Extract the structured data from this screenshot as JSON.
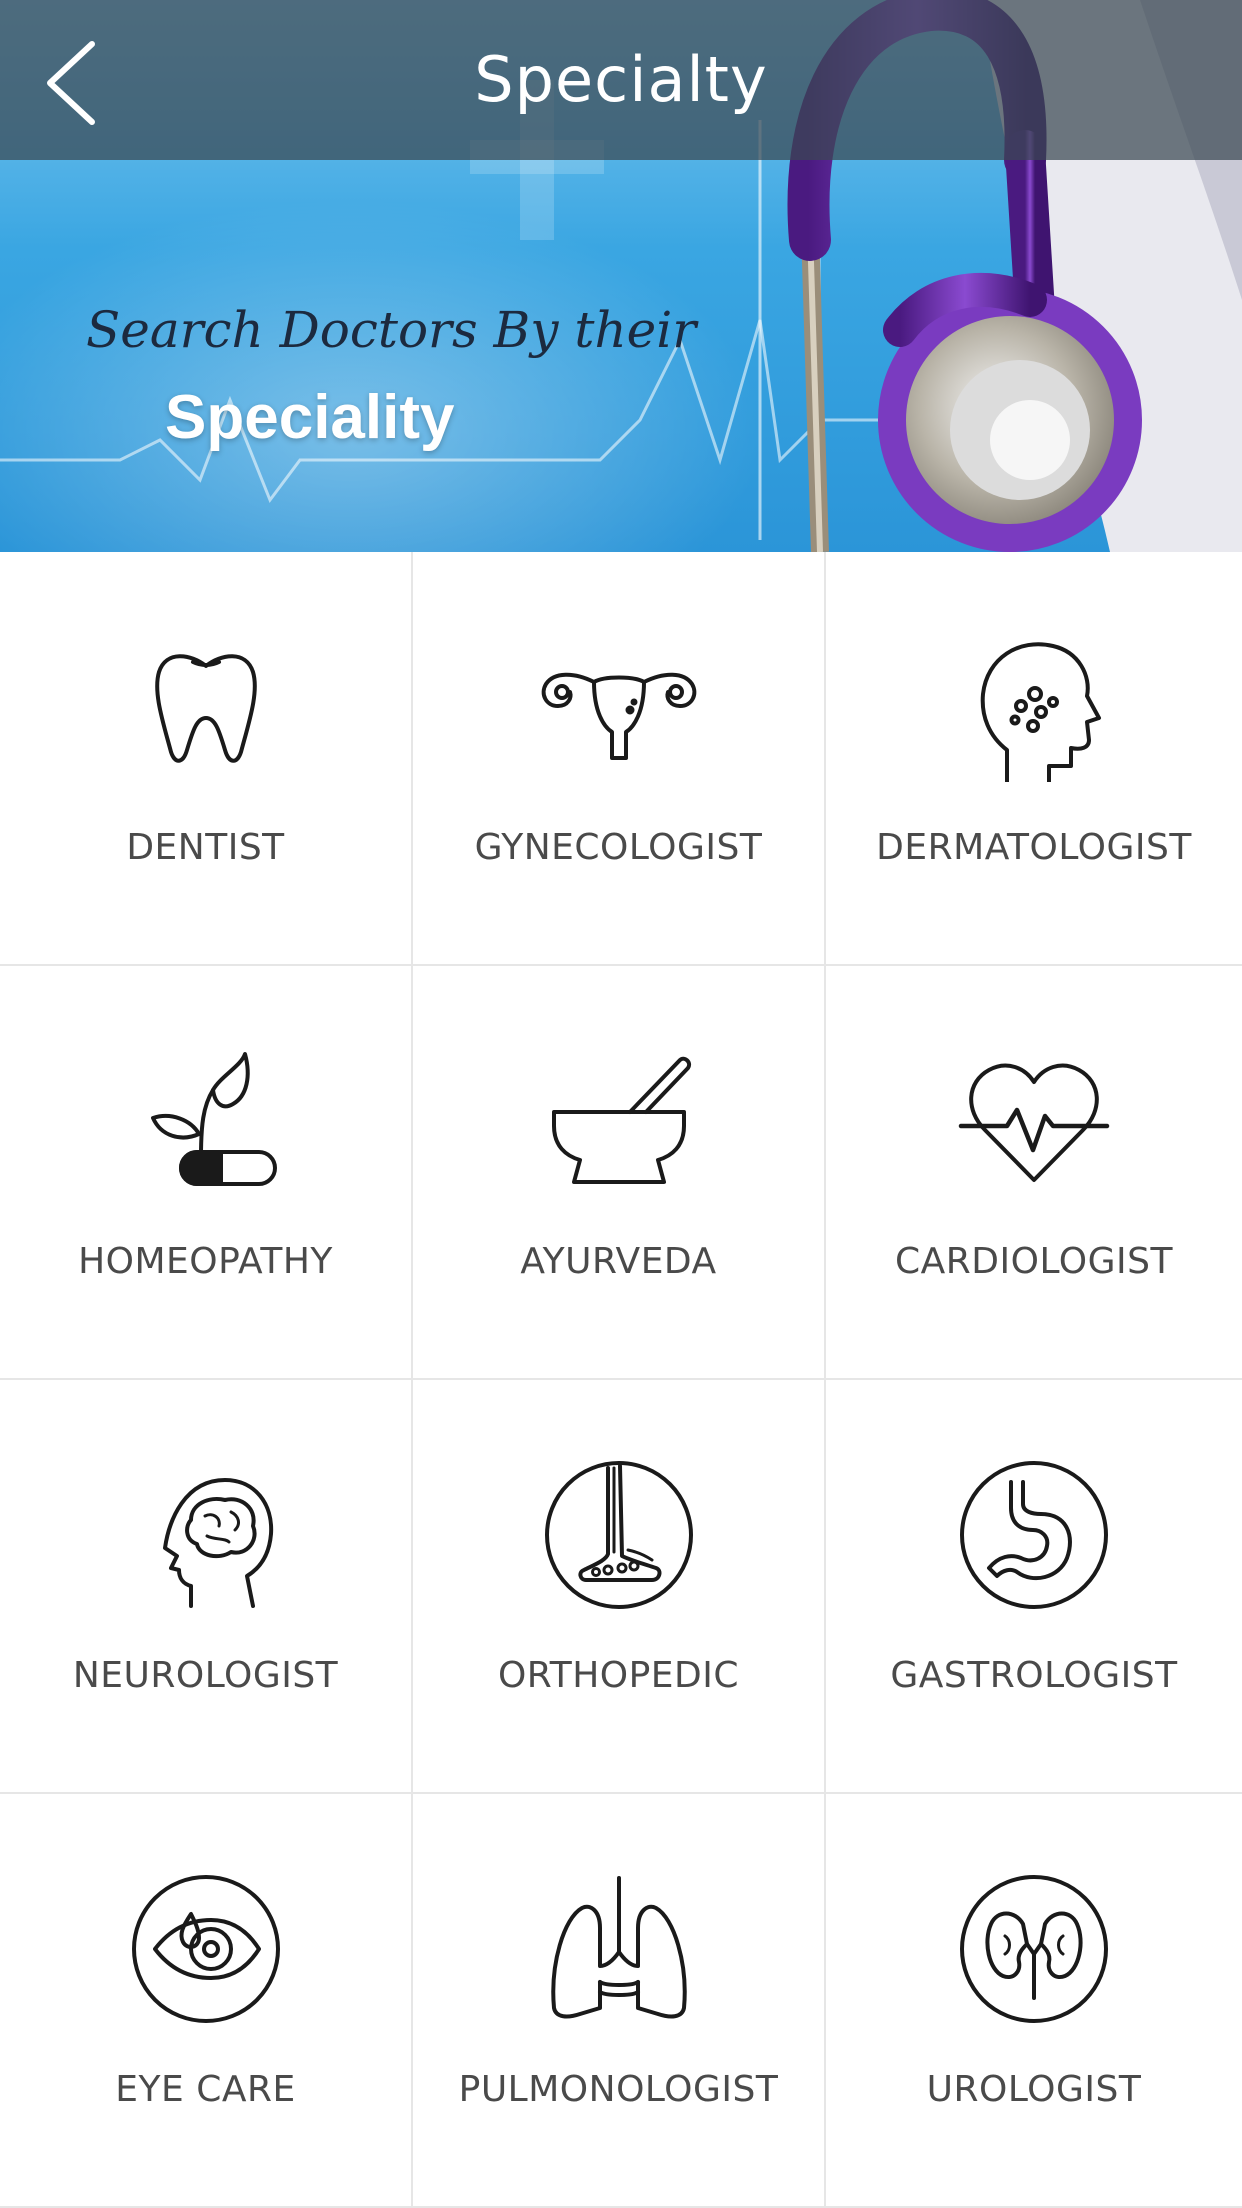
{
  "header": {
    "title": "Specialty",
    "back_icon": "chevron-left-icon"
  },
  "banner": {
    "line1": "Search Doctors By their",
    "line2": "Speciality"
  },
  "specialties": [
    {
      "label": "DENTIST",
      "icon": "tooth-icon"
    },
    {
      "label": "GYNECOLOGIST",
      "icon": "uterus-icon"
    },
    {
      "label": "DERMATOLOGIST",
      "icon": "face-skin-icon"
    },
    {
      "label": "HOMEOPATHY",
      "icon": "leaf-pill-icon"
    },
    {
      "label": "AYURVEDA",
      "icon": "mortar-pestle-icon"
    },
    {
      "label": "CARDIOLOGIST",
      "icon": "heart-pulse-icon"
    },
    {
      "label": "NEUROLOGIST",
      "icon": "brain-head-icon"
    },
    {
      "label": "ORTHOPEDIC",
      "icon": "foot-bone-icon"
    },
    {
      "label": "GASTROLOGIST",
      "icon": "stomach-icon"
    },
    {
      "label": "EYE CARE",
      "icon": "eye-icon"
    },
    {
      "label": "PULMONOLOGIST",
      "icon": "lungs-icon"
    },
    {
      "label": "UROLOGIST",
      "icon": "kidneys-icon"
    }
  ],
  "colors": {
    "titlebar": "#3a4852",
    "banner_blue": "#3aa6e2",
    "stethoscope": "#6a2ea3",
    "label_text": "#4a4a4a",
    "divider": "#e6e6e6"
  }
}
